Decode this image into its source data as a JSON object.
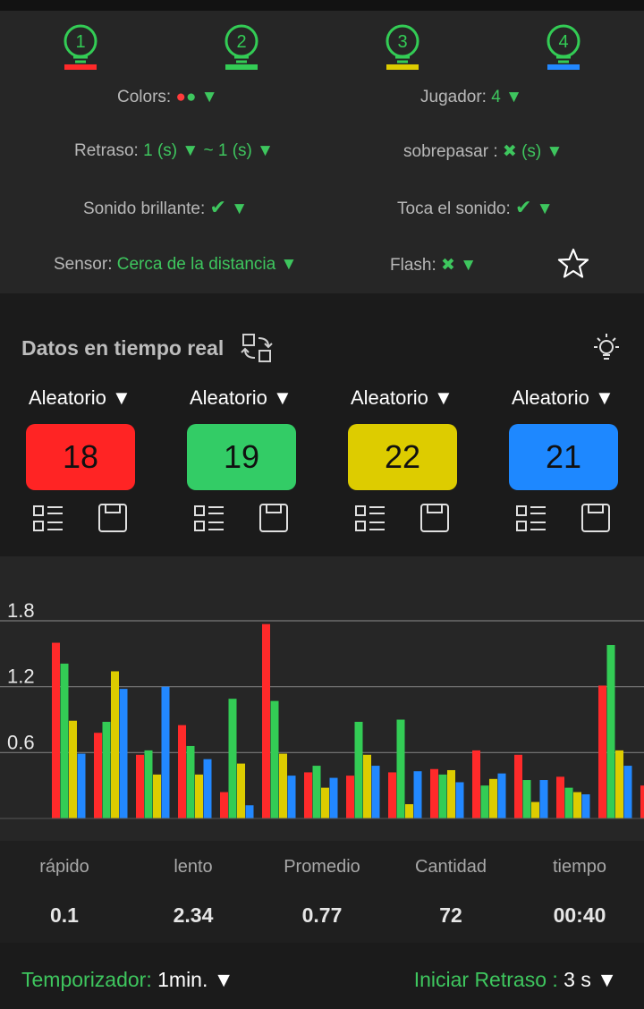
{
  "players": [
    {
      "number": "1",
      "color": "#ff2a2a"
    },
    {
      "number": "2",
      "color": "#33cc55"
    },
    {
      "number": "3",
      "color": "#ddcc00"
    },
    {
      "number": "4",
      "color": "#2288ff"
    }
  ],
  "settings": {
    "colors_label": "Colors:",
    "colors_dots": "●●",
    "dropdown_arrow": "▼",
    "jugador_label": "Jugador:",
    "jugador_value": "4",
    "retraso_label": "Retraso:",
    "retraso_value": "1 (s)",
    "retraso_sep": "~",
    "retraso_value2": "1 (s)",
    "sobrepasar_label": "sobrepasar :",
    "sobrepasar_value": "✖",
    "sobrepasar_unit": "(s)",
    "sonido_brillante_label": "Sonido brillante:",
    "sonido_brillante_value": "✔",
    "toca_sonido_label": "Toca el sonido:",
    "toca_sonido_value": "✔",
    "sensor_label": "Sensor:",
    "sensor_value": "Cerca de la distancia",
    "flash_label": "Flash:",
    "flash_value": "✖"
  },
  "realtime": {
    "title": "Datos en tiempo real",
    "modes": [
      "Aleatorio ▼",
      "Aleatorio ▼",
      "Aleatorio ▼",
      "Aleatorio ▼"
    ],
    "counts": [
      "18",
      "19",
      "22",
      "21"
    ],
    "counter_colors": [
      "#ff2424",
      "#33cc66",
      "#ddcc00",
      "#1e88ff"
    ]
  },
  "chart_data": {
    "type": "bar",
    "yticks": [
      "0.6",
      "1.2",
      "1.8"
    ],
    "ylim": [
      0,
      1.8
    ],
    "grid": true,
    "series_colors": [
      "#ff2a2a",
      "#33cc55",
      "#ddcc00",
      "#2288ff"
    ],
    "groups": [
      [
        1.6,
        1.41,
        0.89,
        0.59
      ],
      [
        0.78,
        0.88,
        1.34,
        1.18
      ],
      [
        0.58,
        0.62,
        0.4,
        1.2
      ],
      [
        0.85,
        0.66,
        0.4,
        0.54
      ],
      [
        0.24,
        1.09,
        0.5,
        0.12
      ],
      [
        1.77,
        1.07,
        0.59,
        0.39
      ],
      [
        0.42,
        0.48,
        0.28,
        0.37
      ],
      [
        0.39,
        0.88,
        0.58,
        0.48
      ],
      [
        0.42,
        0.9,
        0.13,
        0.43
      ],
      [
        0.45,
        0.4,
        0.44,
        0.33
      ],
      [
        0.62,
        0.3,
        0.36,
        0.41
      ],
      [
        0.58,
        0.35,
        0.15,
        0.35
      ],
      [
        0.38,
        0.28,
        0.24,
        0.22
      ],
      [
        1.21,
        1.58,
        0.62,
        0.48
      ],
      [
        0.3,
        0,
        0,
        0
      ]
    ]
  },
  "stats": {
    "labels": [
      "rápido",
      "lento",
      "Promedio",
      "Cantidad",
      "tiempo"
    ],
    "values": [
      "0.1",
      "2.34",
      "0.77",
      "72",
      "00:40"
    ]
  },
  "footer": {
    "timer_label": "Temporizador:",
    "timer_value": "1min.",
    "timer_arrow": "▼",
    "start_delay_label": "Iniciar Retraso :",
    "start_delay_value": "3 s",
    "start_delay_arrow": "▼"
  }
}
